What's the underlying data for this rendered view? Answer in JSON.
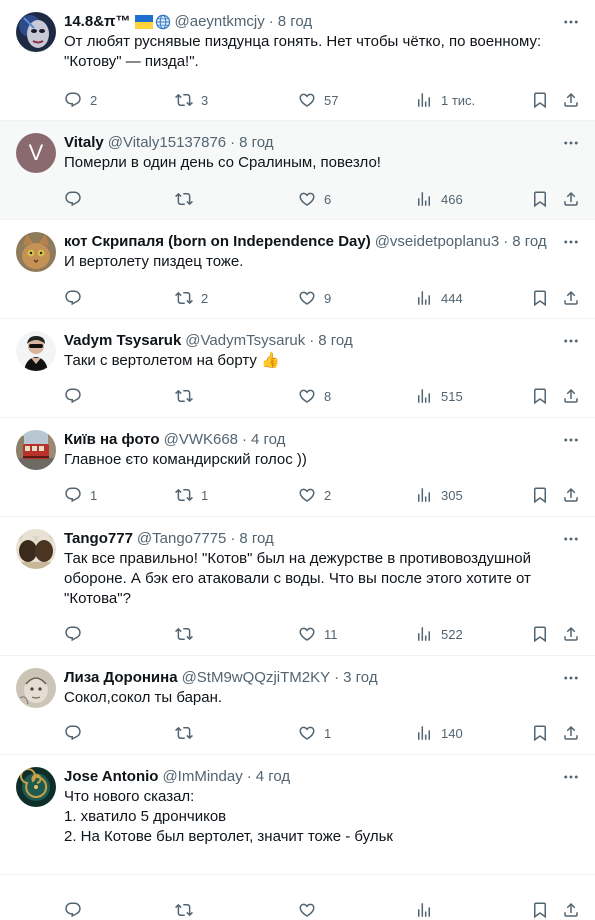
{
  "replies": [
    {
      "name": "14.8&π™",
      "handle": "@aeyntkmcjy",
      "time": "8 год",
      "lines": [
        "От любят руснявые пиздунца гонять. Нет чтобы чётко, по военному:",
        "\"Котову\" — пизда!\"."
      ],
      "reply_count": "2",
      "repost_count": "3",
      "like_count": "57",
      "views": "1 тис.",
      "has_flag": true,
      "avatar": "mask-avatar"
    },
    {
      "name": "Vitaly",
      "handle": "@Vitaly15137876",
      "time": "8 год",
      "lines": [
        "Померли в один день со Сралиным, повезло!"
      ],
      "reply_count": "",
      "repost_count": "",
      "like_count": "6",
      "views": "466",
      "avatar_letter": "V",
      "avatar": "letter-avatar"
    },
    {
      "name": "кот Скрипаля (born on Independence Day)",
      "handle": "@vseidetpoplanu3",
      "time": "8 год",
      "lines": [
        "И вертолету пиздец тоже."
      ],
      "reply_count": "",
      "repost_count": "2",
      "like_count": "9",
      "views": "444",
      "avatar": "cat-avatar"
    },
    {
      "name": "Vadym Tsysaruk",
      "handle": "@VadymTsysaruk",
      "time": "8 год",
      "lines": [
        "Таки с вертолетом на борту 👍"
      ],
      "reply_count": "",
      "repost_count": "",
      "like_count": "8",
      "views": "515",
      "avatar": "person-avatar"
    },
    {
      "name": "Київ на фото",
      "handle": "@VWK668",
      "time": "4 год",
      "lines": [
        "Главное єто командирский голос ))"
      ],
      "reply_count": "1",
      "repost_count": "1",
      "like_count": "2",
      "views": "305",
      "avatar": "tram-avatar"
    },
    {
      "name": "Tango777",
      "handle": "@Tango7775",
      "time": "8 год",
      "lines": [
        "Так все правильно! \"Котов\" был на дежурстве в противовоздушной",
        "обороне. А бэк его атаковали с воды. Что вы после этого хотите от",
        "\"Котова\"?"
      ],
      "reply_count": "",
      "repost_count": "",
      "like_count": "11",
      "views": "522",
      "avatar": "bison-avatar"
    },
    {
      "name": "Лиза Доронина",
      "handle": "@StM9wQQzjiTM2KY",
      "time": "3 год",
      "lines": [
        "Сокол,сокол ты баран."
      ],
      "reply_count": "",
      "repost_count": "",
      "like_count": "1",
      "views": "140",
      "avatar": "sketch-avatar"
    },
    {
      "name": "Jose Antonio",
      "handle": "@ImMinday",
      "time": "4 год",
      "lines": [
        "Что нового сказал:",
        "1. хватило 5 дрончиков",
        "2. На Котове был вертолет, значит тоже - бульк"
      ],
      "reply_count": "",
      "repost_count": "",
      "like_count": "",
      "views": "",
      "avatar": "shell-avatar"
    }
  ],
  "colors": {
    "text": "#0f1419",
    "muted": "#536471",
    "divider": "#eff3f4",
    "highlight_bg": "#f7f9f9",
    "letter_avatar_bg": "#8b6a6f"
  }
}
